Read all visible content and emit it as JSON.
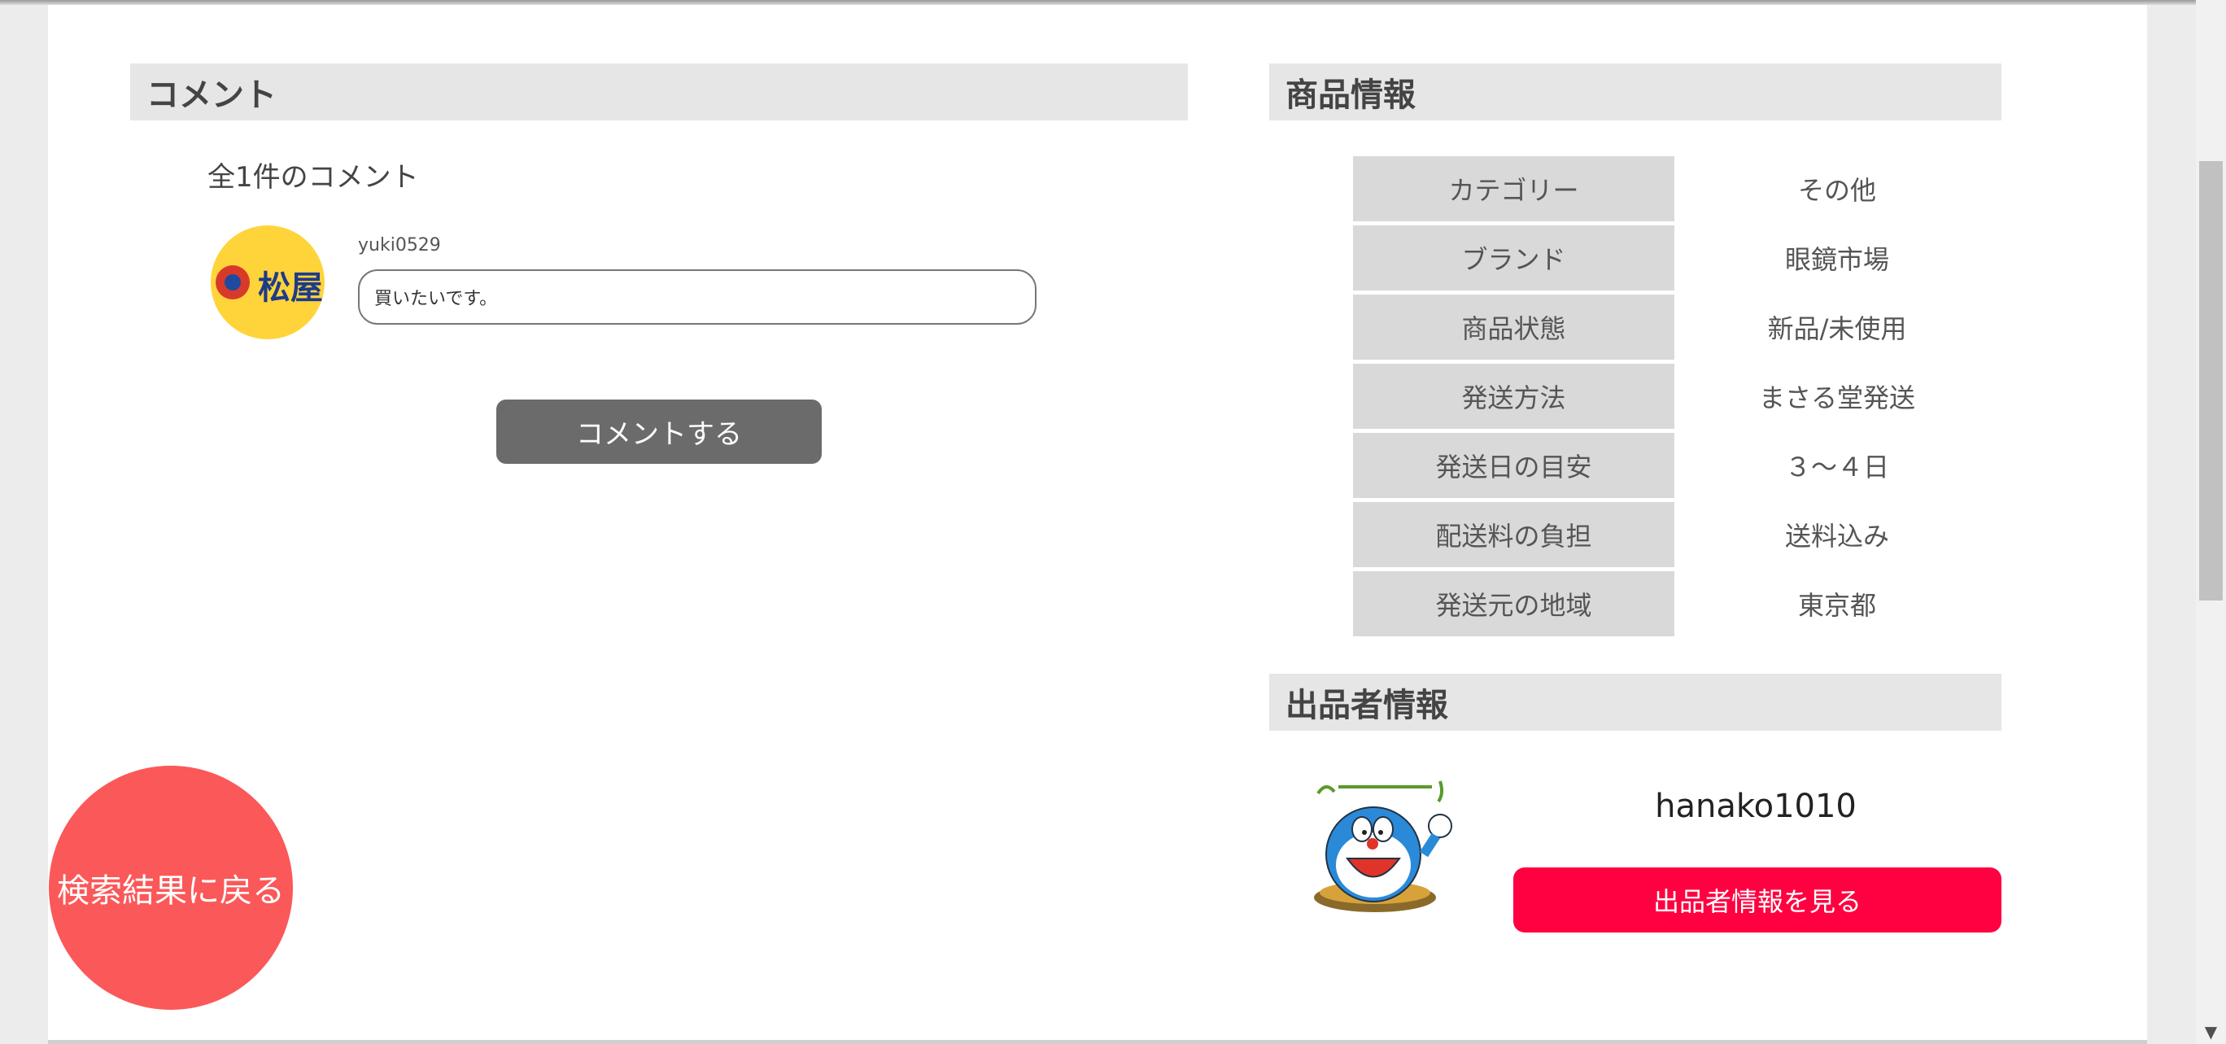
{
  "comments": {
    "section_title": "コメント",
    "count_text": "全1件のコメント",
    "items": [
      {
        "avatar_logo_text": "松屋",
        "user": "yuki0529",
        "text": "買いたいです。"
      }
    ],
    "submit_label": "コメントする"
  },
  "product_info": {
    "section_title": "商品情報",
    "rows": [
      {
        "label": "カテゴリー",
        "value": "その他"
      },
      {
        "label": "ブランド",
        "value": "眼鏡市場"
      },
      {
        "label": "商品状態",
        "value": "新品/未使用"
      },
      {
        "label": "発送方法",
        "value": "まさる堂発送"
      },
      {
        "label": "発送日の目安",
        "value": "３～４日"
      },
      {
        "label": "配送料の負担",
        "value": "送料込み"
      },
      {
        "label": "発送元の地域",
        "value": "東京都"
      }
    ]
  },
  "seller": {
    "section_title": "出品者情報",
    "name": "hanako1010",
    "view_button_label": "出品者情報を見る",
    "avatar_icon": "character-avatar-icon"
  },
  "navigation": {
    "back_button_label": "検索結果に戻る"
  },
  "colors": {
    "section_header_bg": "#e6e6e6",
    "comment_button_bg": "#6b6b6b",
    "seller_button_bg": "#ff0040",
    "back_button_bg": "#fb5859",
    "table_label_bg": "#d9d9d9"
  }
}
